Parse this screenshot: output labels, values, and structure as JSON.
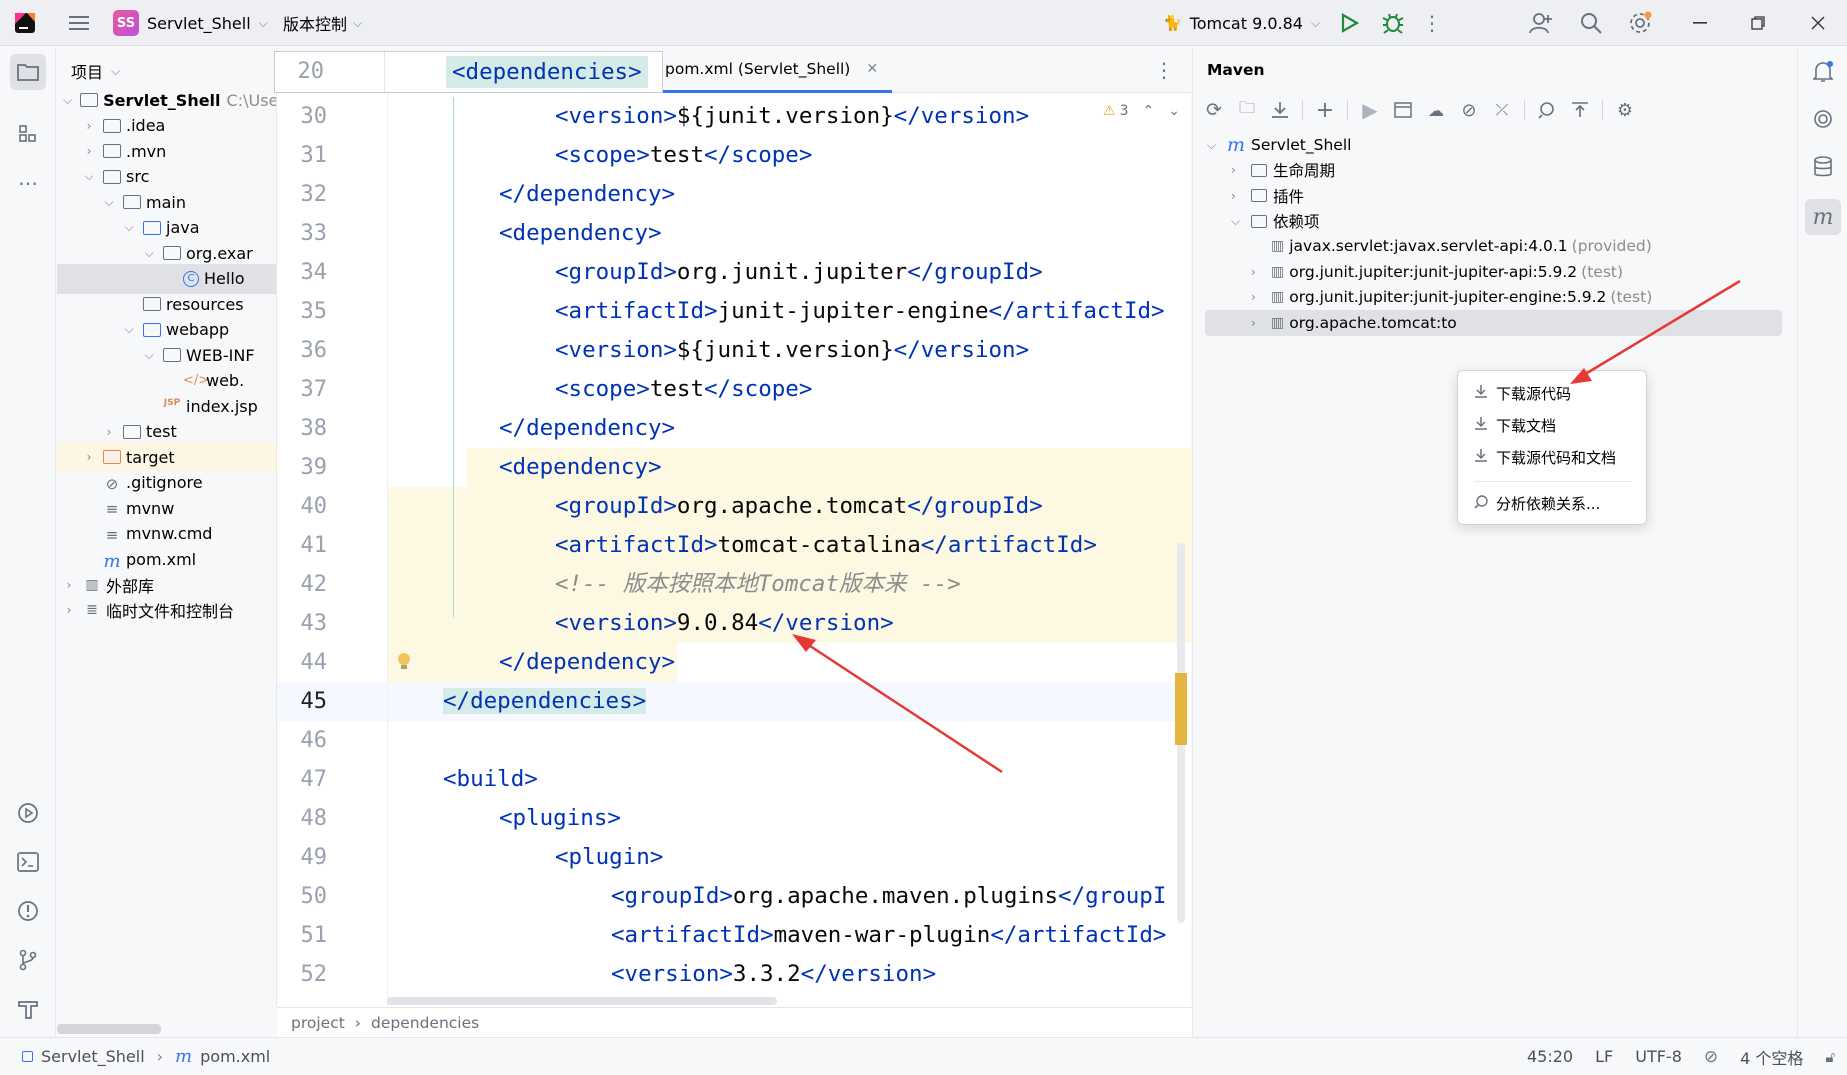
{
  "titlebar": {
    "project_badge": "SS",
    "project_name": "Servlet_Shell",
    "vcs_label": "版本控制",
    "run_config": "Tomcat 9.0.84"
  },
  "project_panel": {
    "title": "项目",
    "tree": [
      {
        "label": "Servlet_Shell",
        "suffix": "C:\\User",
        "depth": 0,
        "icon": "module-folder-icon",
        "expanded": true
      },
      {
        "label": ".idea",
        "depth": 1,
        "icon": "folder-icon",
        "expanded": false
      },
      {
        "label": ".mvn",
        "depth": 1,
        "icon": "folder-icon",
        "expanded": false
      },
      {
        "label": "src",
        "depth": 1,
        "icon": "folder-icon",
        "expanded": true
      },
      {
        "label": "main",
        "depth": 2,
        "icon": "folder-icon",
        "expanded": true
      },
      {
        "label": "java",
        "depth": 3,
        "icon": "source-folder-icon",
        "expanded": true
      },
      {
        "label": "org.exar",
        "depth": 4,
        "icon": "package-icon",
        "expanded": true
      },
      {
        "label": "Hello",
        "depth": 5,
        "icon": "class-icon",
        "selected": true
      },
      {
        "label": "resources",
        "depth": 3,
        "icon": "resources-folder-icon"
      },
      {
        "label": "webapp",
        "depth": 3,
        "icon": "web-folder-icon",
        "expanded": true
      },
      {
        "label": "WEB-INF",
        "depth": 4,
        "icon": "folder-icon",
        "expanded": true
      },
      {
        "label": "web.",
        "depth": 5,
        "icon": "xml-file-icon"
      },
      {
        "label": "index.jsp",
        "depth": 4,
        "icon": "jsp-file-icon"
      },
      {
        "label": "test",
        "depth": 2,
        "icon": "folder-icon",
        "expanded": false
      },
      {
        "label": "target",
        "depth": 1,
        "icon": "excluded-folder-icon",
        "expanded": false,
        "highlight": true
      },
      {
        "label": ".gitignore",
        "depth": 1,
        "icon": "ignore-file-icon"
      },
      {
        "label": "mvnw",
        "depth": 1,
        "icon": "text-file-icon"
      },
      {
        "label": "mvnw.cmd",
        "depth": 1,
        "icon": "text-file-icon"
      },
      {
        "label": "pom.xml",
        "depth": 1,
        "icon": "maven-file-icon"
      },
      {
        "label": "外部库",
        "depth": 0,
        "icon": "library-icon",
        "expanded": false
      },
      {
        "label": "临时文件和控制台",
        "depth": 0,
        "icon": "scratch-icon",
        "expanded": false
      }
    ]
  },
  "editor": {
    "tab_label": "pom.xml (Servlet_Shell)",
    "sticky_line_number": "20",
    "sticky_code": "<dependencies>",
    "warning_count": "3",
    "lines": [
      {
        "n": "30",
        "indent": 2,
        "parts": [
          [
            "t",
            "<version>"
          ],
          [
            "x",
            "${junit.version}"
          ],
          [
            "t",
            "</version>"
          ]
        ]
      },
      {
        "n": "31",
        "indent": 2,
        "parts": [
          [
            "t",
            "<scope>"
          ],
          [
            "x",
            "test"
          ],
          [
            "t",
            "</scope>"
          ]
        ]
      },
      {
        "n": "32",
        "indent": 1,
        "parts": [
          [
            "t",
            "</dependency>"
          ]
        ]
      },
      {
        "n": "33",
        "indent": 1,
        "parts": [
          [
            "t",
            "<dependency>"
          ]
        ]
      },
      {
        "n": "34",
        "indent": 2,
        "parts": [
          [
            "t",
            "<groupId>"
          ],
          [
            "x",
            "org.junit.jupiter"
          ],
          [
            "t",
            "</groupId>"
          ]
        ]
      },
      {
        "n": "35",
        "indent": 2,
        "parts": [
          [
            "t",
            "<artifactId>"
          ],
          [
            "x",
            "junit-jupiter-engine"
          ],
          [
            "t",
            "</artifactId>"
          ]
        ]
      },
      {
        "n": "36",
        "indent": 2,
        "parts": [
          [
            "t",
            "<version>"
          ],
          [
            "x",
            "${junit.version}"
          ],
          [
            "t",
            "</version>"
          ]
        ]
      },
      {
        "n": "37",
        "indent": 2,
        "parts": [
          [
            "t",
            "<scope>"
          ],
          [
            "x",
            "test"
          ],
          [
            "t",
            "</scope>"
          ]
        ]
      },
      {
        "n": "38",
        "indent": 1,
        "parts": [
          [
            "t",
            "</dependency>"
          ]
        ]
      },
      {
        "n": "39",
        "indent": 1,
        "parts": [
          [
            "t",
            "<dependency>"
          ]
        ],
        "hl": true
      },
      {
        "n": "40",
        "indent": 2,
        "parts": [
          [
            "t",
            "<groupId>"
          ],
          [
            "x",
            "org.apache.tomcat"
          ],
          [
            "t",
            "</groupId>"
          ]
        ],
        "hl": true
      },
      {
        "n": "41",
        "indent": 2,
        "parts": [
          [
            "t",
            "<artifactId>"
          ],
          [
            "x",
            "tomcat-catalina"
          ],
          [
            "t",
            "</artifactId>"
          ]
        ],
        "hl": true
      },
      {
        "n": "42",
        "indent": 2,
        "parts": [
          [
            "c",
            "<!-- 版本按照本地Tomcat版本来 -->"
          ]
        ],
        "hl": true
      },
      {
        "n": "43",
        "indent": 2,
        "parts": [
          [
            "t",
            "<version>"
          ],
          [
            "x",
            "9.0.84"
          ],
          [
            "t",
            "</version>"
          ]
        ],
        "hl": true
      },
      {
        "n": "44",
        "indent": 1,
        "parts": [
          [
            "t",
            "</dependency>"
          ]
        ],
        "hl": true,
        "bulb": true
      },
      {
        "n": "45",
        "indent": 0,
        "parts": [
          [
            "t",
            "</dependencies>"
          ]
        ],
        "current": true
      },
      {
        "n": "46",
        "indent": 0,
        "parts": []
      },
      {
        "n": "47",
        "indent": 0,
        "parts": [
          [
            "t",
            "<build>"
          ]
        ]
      },
      {
        "n": "48",
        "indent": 1,
        "parts": [
          [
            "t",
            "<plugins>"
          ]
        ]
      },
      {
        "n": "49",
        "indent": 2,
        "parts": [
          [
            "t",
            "<plugin>"
          ]
        ]
      },
      {
        "n": "50",
        "indent": 3,
        "parts": [
          [
            "t",
            "<groupId>"
          ],
          [
            "x",
            "org.apache.maven.plugins"
          ],
          [
            "t",
            "</groupI"
          ]
        ]
      },
      {
        "n": "51",
        "indent": 3,
        "parts": [
          [
            "t",
            "<artifactId>"
          ],
          [
            "x",
            "maven-war-plugin"
          ],
          [
            "t",
            "</artifactId>"
          ]
        ]
      },
      {
        "n": "52",
        "indent": 3,
        "parts": [
          [
            "t",
            "<version>"
          ],
          [
            "x",
            "3.3.2"
          ],
          [
            "t",
            "</version>"
          ]
        ]
      }
    ],
    "breadcrumb": [
      "project",
      "dependencies"
    ]
  },
  "maven": {
    "title": "Maven",
    "root": "Servlet_Shell",
    "nodes": [
      {
        "label": "生命周期",
        "depth": 1
      },
      {
        "label": "插件",
        "depth": 1
      },
      {
        "label": "依赖项",
        "depth": 1,
        "expanded": true
      }
    ],
    "deps": [
      {
        "name": "javax.servlet:javax.servlet-api:4.0.1",
        "scope": "(provided)",
        "chev": false
      },
      {
        "name": "org.junit.jupiter:junit-jupiter-api:5.9.2",
        "scope": "(test)",
        "chev": true
      },
      {
        "name": "org.junit.jupiter:junit-jupiter-engine:5.9.2",
        "scope": "(test)",
        "chev": true
      },
      {
        "name": "org.apache.tomcat:to",
        "scope": "",
        "chev": true,
        "selected": true
      }
    ]
  },
  "context_menu": {
    "items": [
      "下载源代码",
      "下载文档",
      "下载源代码和文档",
      "分析依赖关系..."
    ]
  },
  "statusbar": {
    "crumbs": [
      "Servlet_Shell",
      "pom.xml"
    ],
    "position": "45:20",
    "line_sep": "LF",
    "encoding": "UTF-8",
    "indent": "4 个空格"
  },
  "colors": {
    "accent": "#3574f0",
    "annotation_arrow": "#e53935",
    "highlight_bg": "#fdf8e1"
  }
}
